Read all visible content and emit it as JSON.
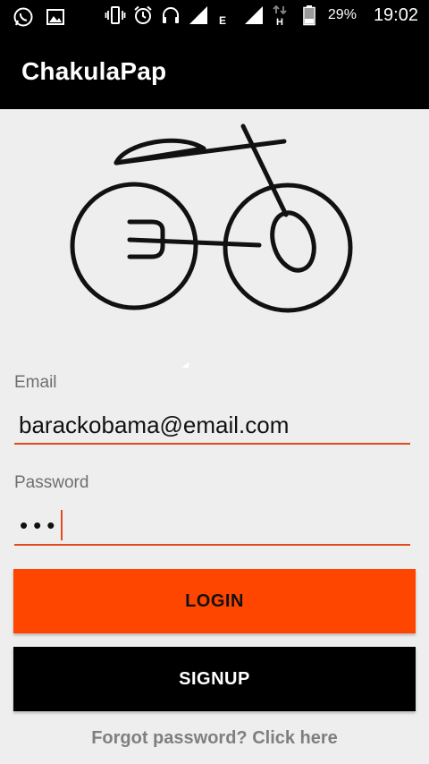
{
  "status_bar": {
    "icons_left": [
      "whatsapp-icon",
      "gallery-icon"
    ],
    "icons_right": [
      "vibrate-icon",
      "alarm-icon",
      "headset-icon",
      "signal-icon",
      "edge-network-icon",
      "signal-icon-2",
      "hplus-network-icon",
      "battery-icon"
    ],
    "network_labels": {
      "edge": "E",
      "hspa": "H"
    },
    "battery": "29%",
    "time": "19:02"
  },
  "app_bar": {
    "title": "ChakulaPap"
  },
  "logo": {
    "icon": "bicycle-fork-logo"
  },
  "form": {
    "email_label": "Email",
    "email_value": "barackobama@email.com",
    "password_label": "Password",
    "password_value": "•••"
  },
  "buttons": {
    "login": "LOGIN",
    "signup": "SIGNUP"
  },
  "forgot": "Forgot password? Click here",
  "colors": {
    "accent": "#ff4600",
    "underline": "#e3491f",
    "bar": "#000000",
    "background": "#eeeeee"
  }
}
